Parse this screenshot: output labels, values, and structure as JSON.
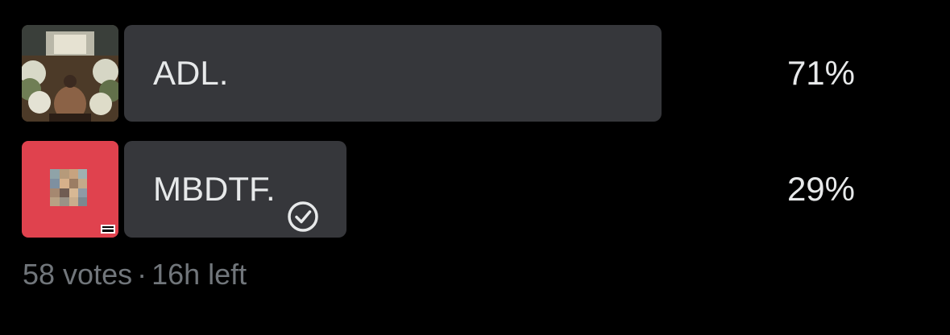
{
  "poll": {
    "options": [
      {
        "label": "ADL.",
        "percent": "71%",
        "share": 0.71,
        "selected": false,
        "thumbnail_icon": "album-cover-adl"
      },
      {
        "label": "MBDTF.",
        "percent": "29%",
        "share": 0.29,
        "selected": true,
        "thumbnail_icon": "album-cover-mbdtf",
        "selected_icon": "check-circle-icon"
      }
    ],
    "votes": "58 votes",
    "separator": "·",
    "time_left": "16h left"
  },
  "colors": {
    "background": "#000000",
    "bar": "#36373b",
    "text": "#e7e9ea",
    "muted": "#71767b",
    "mbdtf_red": "#e0424e"
  }
}
